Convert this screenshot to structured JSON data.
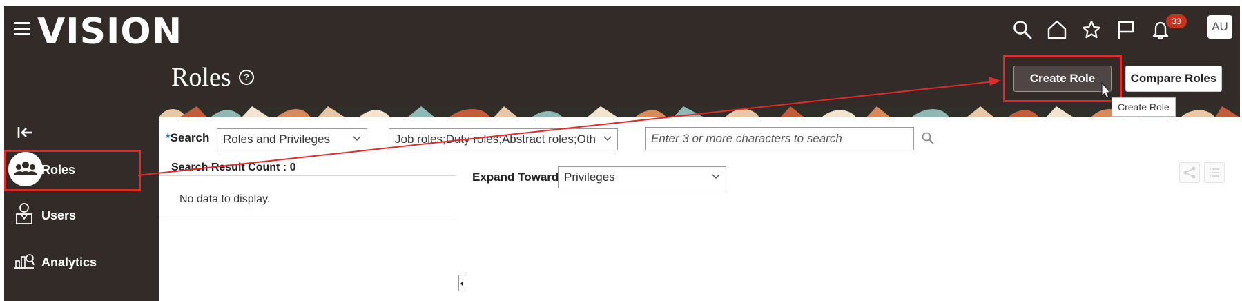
{
  "header": {
    "logo": "VISION",
    "notification_count": "33",
    "avatar_initials": "AU"
  },
  "page": {
    "title": "Roles",
    "help_glyph": "?"
  },
  "actions": {
    "create_label": "Create Role",
    "compare_label": "Compare Roles",
    "tooltip": "Create Role"
  },
  "sidebar": {
    "items": [
      {
        "label": "Roles",
        "icon": "roles-icon",
        "active": true
      },
      {
        "label": "Users",
        "icon": "user-icon"
      },
      {
        "label": "Analytics",
        "icon": "analytics-icon"
      }
    ]
  },
  "search": {
    "required_mark": "*",
    "label": "Search",
    "type_value": "Roles and Privileges",
    "roles_value": "Job roles;Duty roles;Abstract roles;Oth",
    "keyword_placeholder": "Enter 3 or more characters to search"
  },
  "results": {
    "count_label": "Search Result Count : 0",
    "empty_message": "No data to display."
  },
  "expand": {
    "label": "Expand Toward",
    "value": "Privileges"
  },
  "colors": {
    "header_bg": "#322b28",
    "highlight": "#e02b2b",
    "badge": "#c8321e",
    "required": "#1d6fb8"
  }
}
